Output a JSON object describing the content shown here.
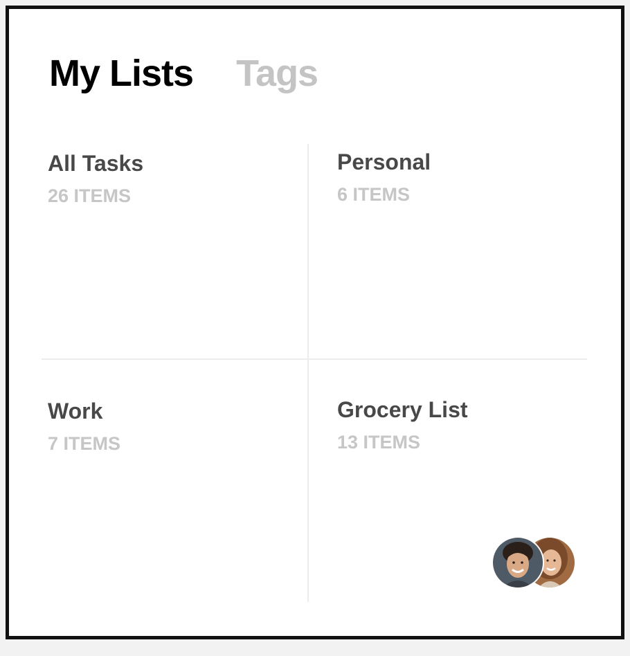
{
  "tabs": [
    {
      "label": "My Lists",
      "active": true
    },
    {
      "label": "Tags",
      "active": false
    }
  ],
  "lists": [
    {
      "title": "All Tasks",
      "count": "26 ITEMS"
    },
    {
      "title": "Personal",
      "count": "6 ITEMS"
    },
    {
      "title": "Work",
      "count": "7 ITEMS"
    },
    {
      "title": "Grocery List",
      "count": "13 ITEMS"
    }
  ],
  "shared_with": [
    "user-avatar-man",
    "user-avatar-woman"
  ],
  "colors": {
    "active_tab": "#000000",
    "inactive_tab": "#c4c4c4",
    "title_text": "#484848",
    "count_text": "#c6c6c6",
    "divider": "#ececec"
  }
}
